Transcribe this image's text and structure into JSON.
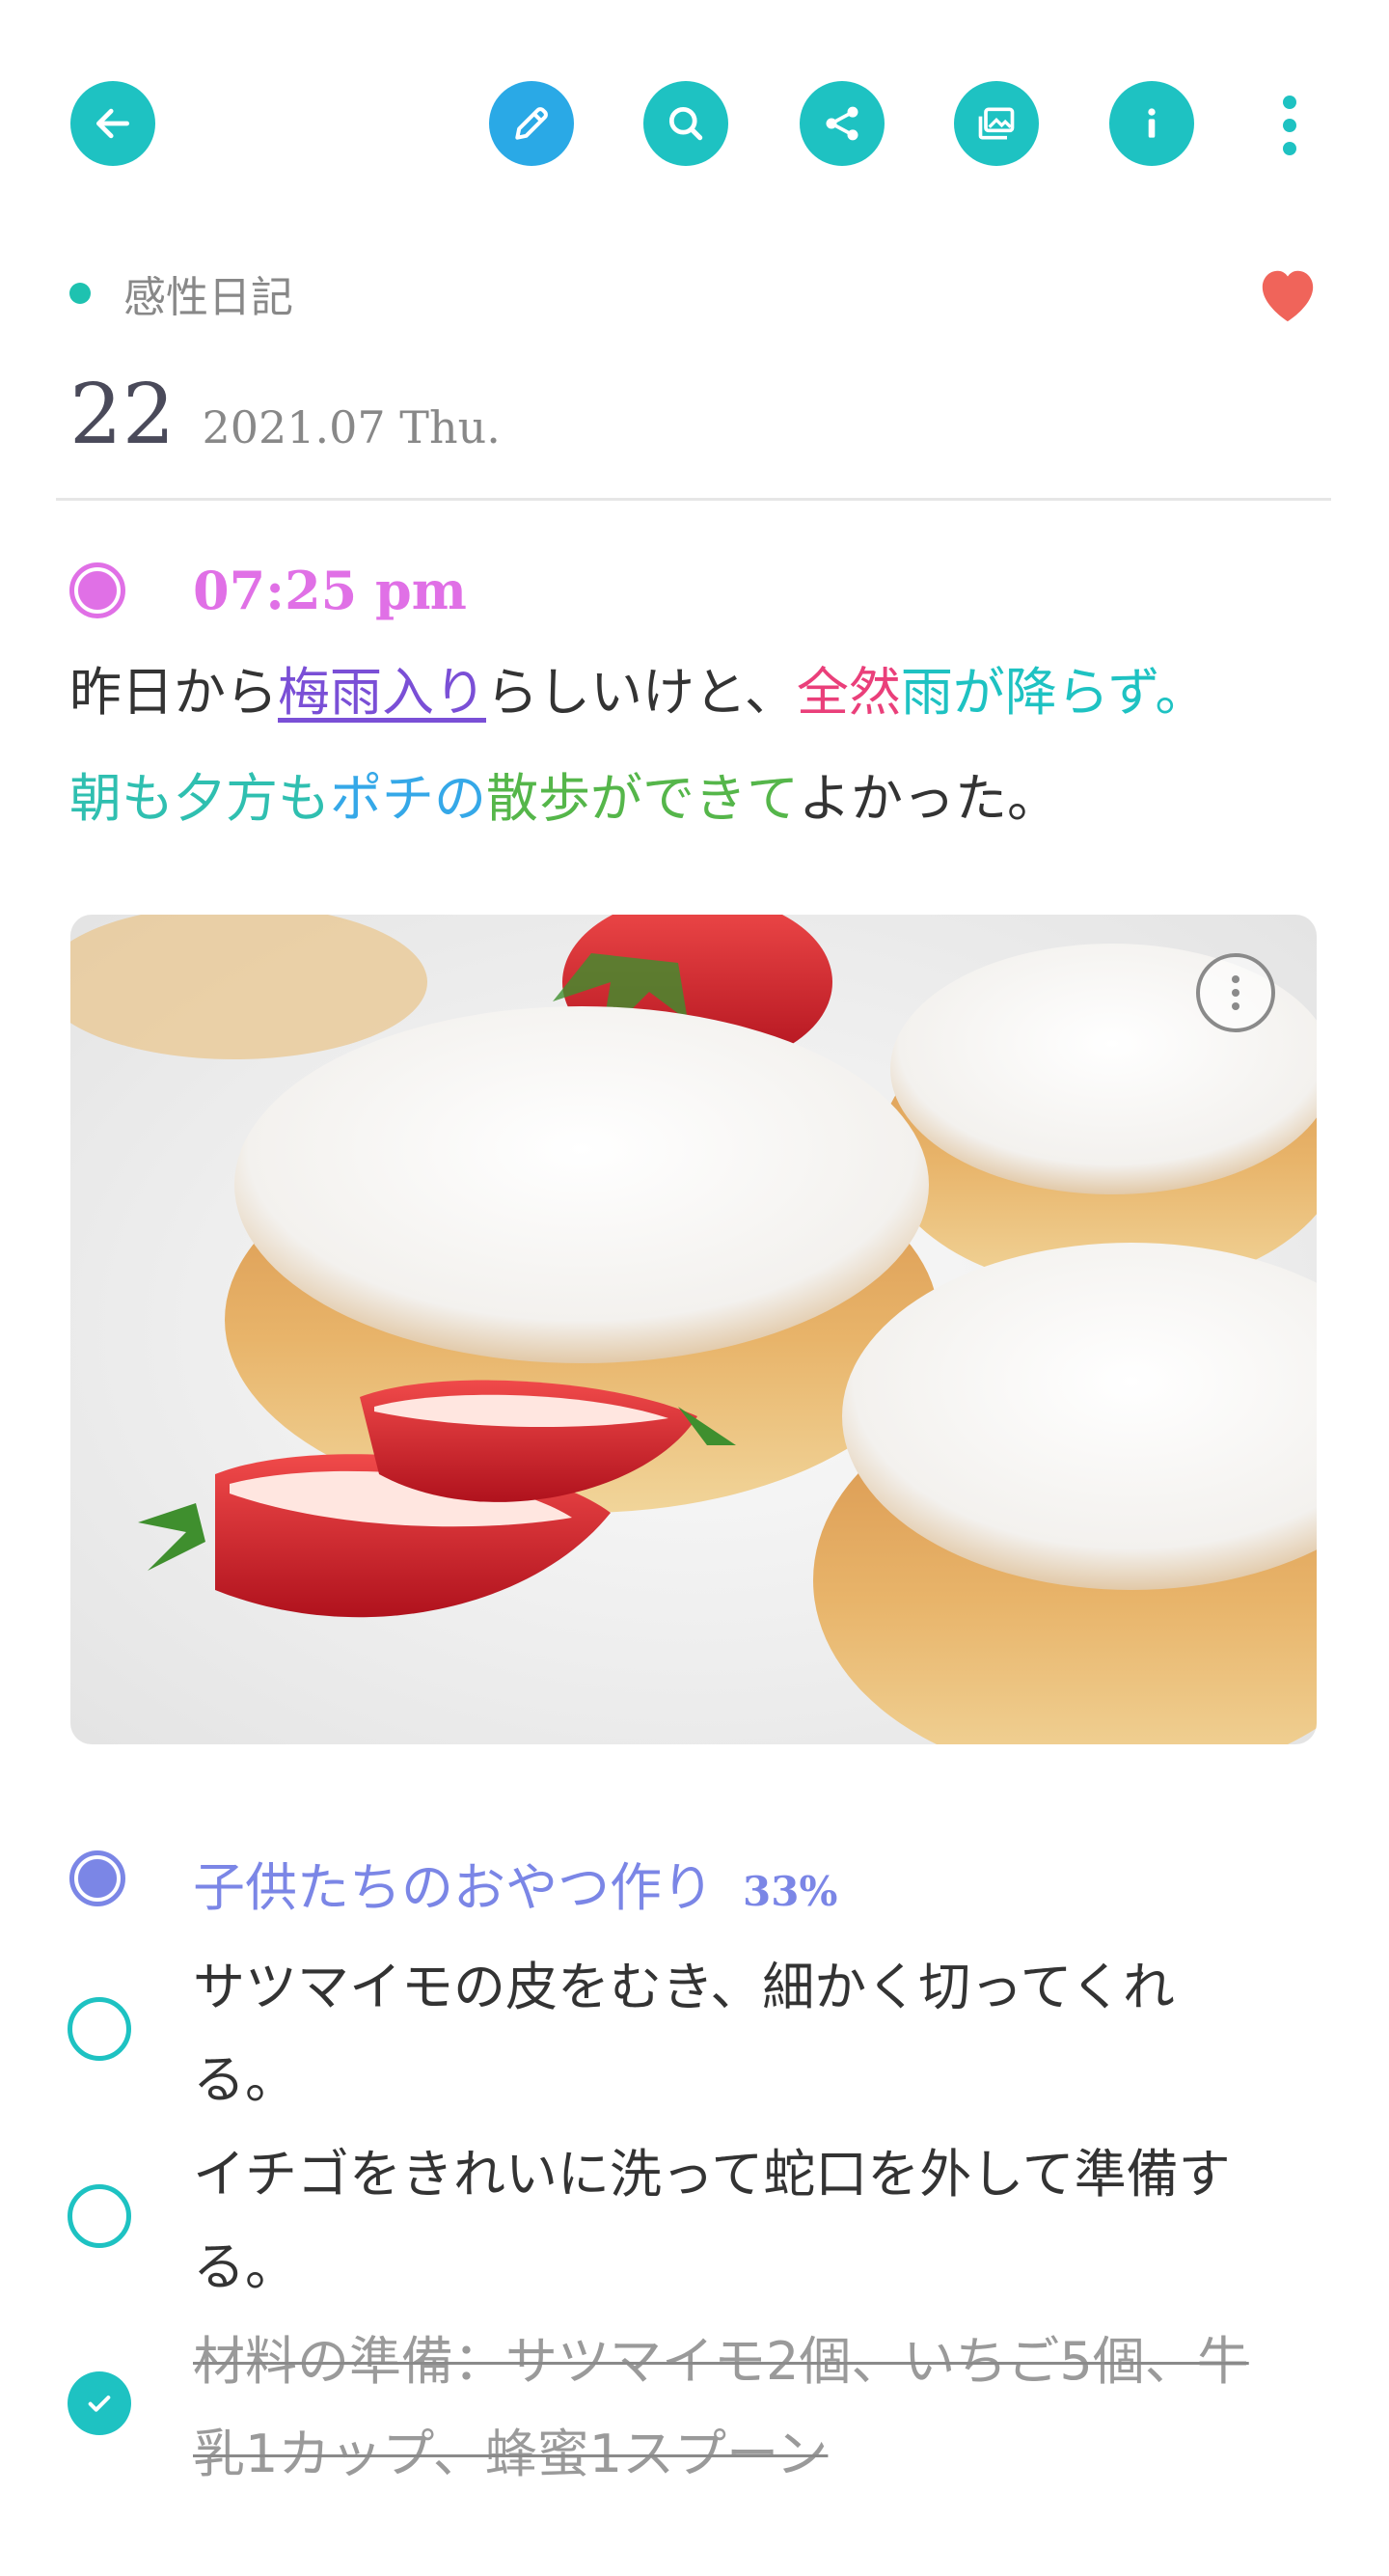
{
  "toolbar": {
    "accent": "#1ec2c2",
    "edit_accent": "#2aa9e6",
    "icons": [
      "back-arrow-icon",
      "pencil-icon",
      "search-icon",
      "share-icon",
      "gallery-icon",
      "info-icon",
      "more-vertical-icon"
    ]
  },
  "diary": {
    "category": "感性日記",
    "favorite": true,
    "day": "22",
    "month_year": "2021.07 Thu."
  },
  "entry": {
    "time": "07:25 pm",
    "dot_color": "#e070e6",
    "line1": [
      {
        "text": "昨日から",
        "color": "#333333"
      },
      {
        "text": "梅雨入り",
        "color": "#7a4fd6"
      },
      {
        "text": "らしいけと、",
        "color": "#333333"
      },
      {
        "text": "全然",
        "color": "#ea3f7a"
      },
      {
        "text": "雨が降らず。",
        "color": "#1ec2c2"
      }
    ],
    "line2": [
      {
        "text": "朝も夕方も",
        "color": "#2fbfb0"
      },
      {
        "text": "ポチの",
        "color": "#35a8e8"
      },
      {
        "text": "散歩ができて",
        "color": "#55b64a"
      },
      {
        "text": "よかった。",
        "color": "#333333"
      }
    ]
  },
  "todo": {
    "title": "子供たちのおやつ作り",
    "percent": "33%",
    "accent": "#7b86e6",
    "items": [
      {
        "text": "サツマイモの皮をむき、細かく切ってくれる。",
        "done": false
      },
      {
        "text": "イチゴをきれいに洗って蛇口を外して準備する。",
        "done": false
      },
      {
        "text": "材料の準備：サツマイモ2個、いちご5個、牛乳1カップ、蜂蜜1スプーン",
        "done": true
      }
    ]
  }
}
